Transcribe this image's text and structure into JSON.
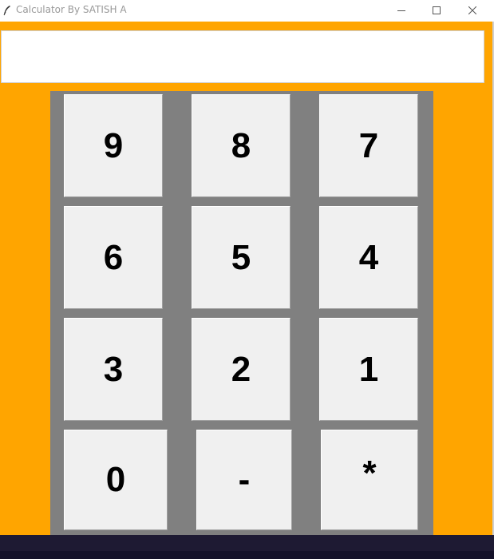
{
  "window": {
    "title": "Calculator By SATISH A",
    "icon": "feather-icon",
    "controls": [
      "minimize-icon",
      "maximize-icon",
      "close-icon"
    ]
  },
  "display": {
    "value": ""
  },
  "keys": [
    {
      "label": "9"
    },
    {
      "label": "8"
    },
    {
      "label": "7"
    },
    {
      "label": "6"
    },
    {
      "label": "5"
    },
    {
      "label": "4"
    },
    {
      "label": "3"
    },
    {
      "label": "2"
    },
    {
      "label": "1"
    },
    {
      "label": "0"
    },
    {
      "label": "-"
    },
    {
      "label": "*"
    }
  ],
  "colors": {
    "app_background": "#ffa500",
    "keypad_background": "#808080",
    "key_face": "#f0f0f0",
    "taskbar": "#1e1a33"
  }
}
